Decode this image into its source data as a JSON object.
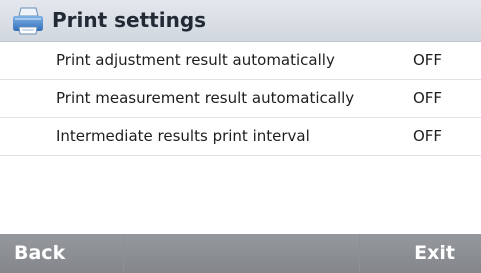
{
  "header": {
    "title": "Print settings",
    "icon": "printer-icon"
  },
  "settings": [
    {
      "label": "Print adjustment result automatically",
      "value": "OFF"
    },
    {
      "label": "Print measurement result automatically",
      "value": "OFF"
    },
    {
      "label": "Intermediate results print interval",
      "value": "OFF"
    }
  ],
  "footer": {
    "back_label": "Back",
    "exit_label": "Exit"
  },
  "colors": {
    "header_bg": "#d9dde4",
    "footer_bg": "#8c8f94",
    "text": "#1e1e1e"
  }
}
